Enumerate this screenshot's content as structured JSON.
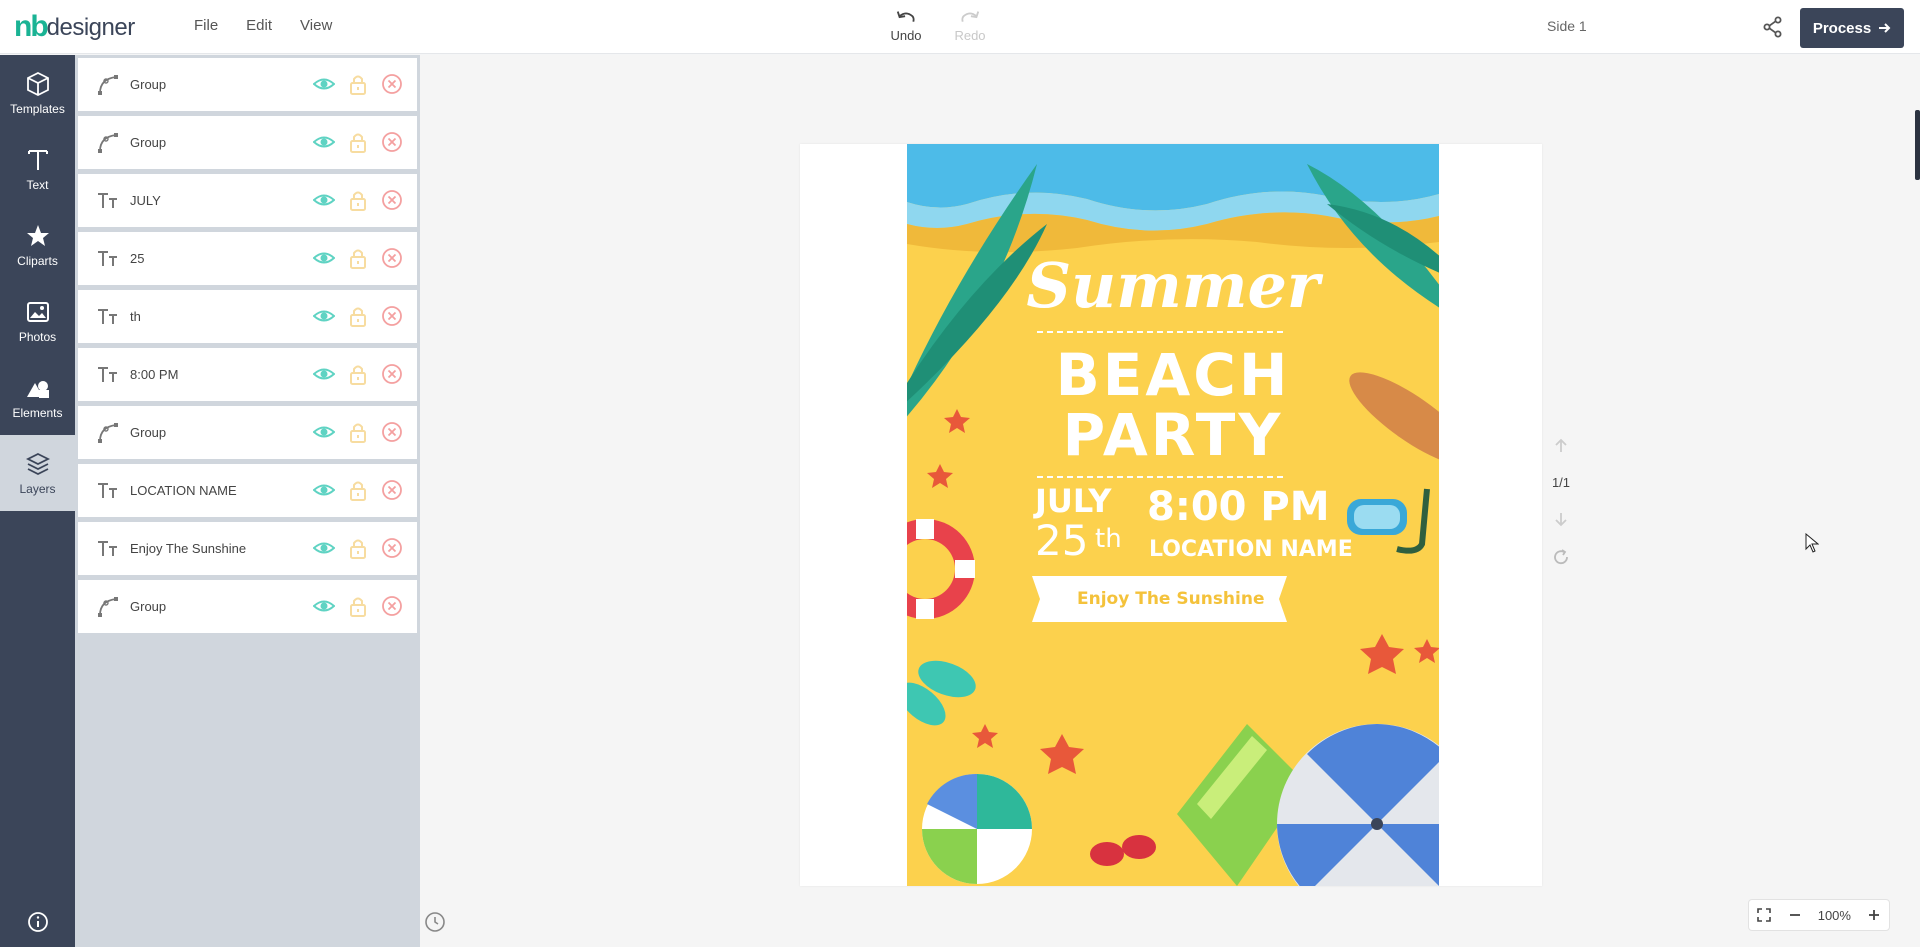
{
  "app": {
    "logo_nb": "nb",
    "logo_designer": "designer"
  },
  "menu": {
    "file": "File",
    "edit": "Edit",
    "view": "View"
  },
  "toolbar": {
    "undo_label": "Undo",
    "redo_label": "Redo",
    "side_label": "Side 1",
    "process_label": "Process"
  },
  "leftnav": {
    "templates": "Templates",
    "text": "Text",
    "cliparts": "Cliparts",
    "photos": "Photos",
    "elements": "Elements",
    "layers": "Layers"
  },
  "layers": [
    {
      "type": "group",
      "name": "Group"
    },
    {
      "type": "group",
      "name": "Group"
    },
    {
      "type": "text",
      "name": "JULY"
    },
    {
      "type": "text",
      "name": "25"
    },
    {
      "type": "text",
      "name": "th"
    },
    {
      "type": "text",
      "name": "8:00 PM"
    },
    {
      "type": "group",
      "name": "Group"
    },
    {
      "type": "text",
      "name": "LOCATION NAME"
    },
    {
      "type": "text",
      "name": "Enjoy The Sunshine"
    },
    {
      "type": "group",
      "name": "Group"
    }
  ],
  "poster": {
    "title": "Summer",
    "line1": "BEACH",
    "line2": "PARTY",
    "month": "JULY",
    "day": "25",
    "suffix": "th",
    "time": "8:00 PM",
    "location": "LOCATION NAME",
    "tagline": "Enjoy The Sunshine"
  },
  "page": {
    "indicator": "1/1"
  },
  "zoom": {
    "level": "100%"
  },
  "colors": {
    "brand": "#1ab394",
    "nav_bg": "#3b4559",
    "panel_bg": "#d0d6dd",
    "poster_sand": "#fcd14d",
    "sea": "#4dbbe8",
    "eye": "#5fd3c3",
    "lock": "#f7dca0",
    "delete": "#f4a0a0"
  },
  "icons": {
    "group": "bezier-curve-icon",
    "text": "text-type-icon",
    "visibility": "eye-icon",
    "lock": "lock-icon",
    "delete": "close-circle-icon"
  }
}
